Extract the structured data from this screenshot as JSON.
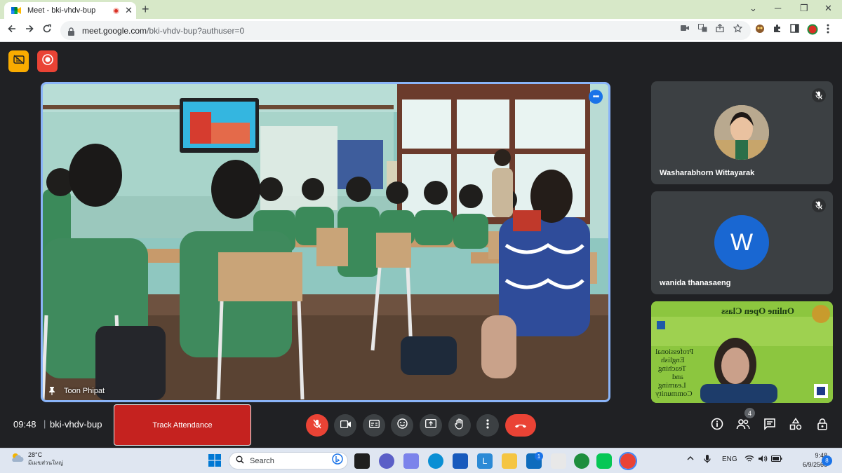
{
  "browser": {
    "tab_title": "Meet - bki-vhdv-bup",
    "tab_close": "✕",
    "new_tab": "+",
    "url_host": "meet.google.com",
    "url_path": "/bki-vhdv-bup?authuser=0",
    "window_min": "─",
    "window_restore": "❐",
    "window_close": "✕",
    "minimize_chevron": "⌄"
  },
  "main_tile": {
    "participant_name": "Toon Phipat",
    "more_glyph": "•••"
  },
  "participants": [
    {
      "name": "Washarabhorn Wittayarak"
    },
    {
      "name": "wanida thanasaeng",
      "initial": "W"
    }
  ],
  "slide": {
    "headline": "Online Open Class",
    "body_lines": [
      "Professional",
      "English",
      "Teaching",
      "and",
      "Learning",
      "Community"
    ]
  },
  "bottom_bar": {
    "time": "09:48",
    "divider": "|",
    "meeting_code": "bki-vhdv-bup",
    "track_attendance": "Track Attendance",
    "people_count": "4"
  },
  "colors": {
    "accent": "#1a73e8",
    "danger": "#ea4335",
    "tile_border": "#8ab4f8",
    "surface": "#3c4043"
  },
  "taskbar": {
    "weather_temp": "28°C",
    "weather_desc": "มีเมฆส่วนใหญ่",
    "search_label": "Search",
    "language": "ENG",
    "clock_time": "9:48",
    "clock_date": "6/9/2566",
    "mail_badge": "1",
    "notification_count": "8"
  }
}
